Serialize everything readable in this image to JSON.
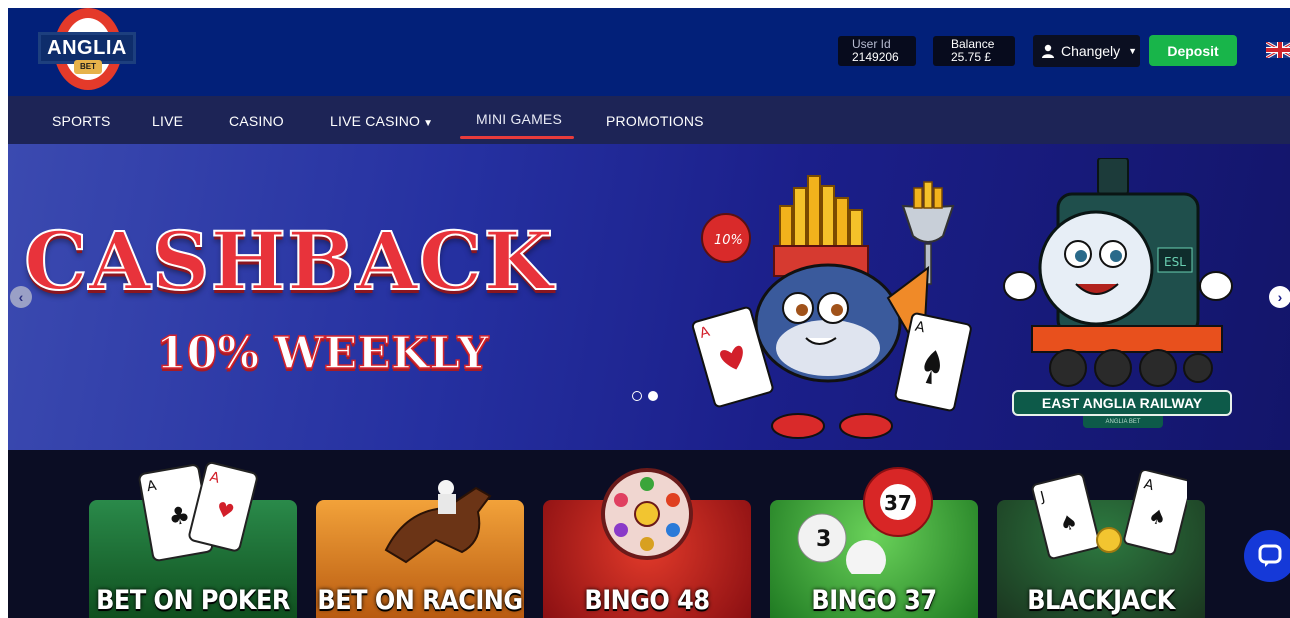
{
  "header": {
    "logo_text": "ANGLIA",
    "logo_sub": "BET",
    "user_id_label": "User Id",
    "user_id_value": "2149206",
    "balance_label": "Balance",
    "balance_value": "25.75 £",
    "user_name": "Changely",
    "deposit_label": "Deposit",
    "flag": "uk-flag"
  },
  "nav": {
    "items": [
      {
        "label": "SPORTS"
      },
      {
        "label": "LIVE"
      },
      {
        "label": "CASINO"
      },
      {
        "label": "LIVE CASINO"
      },
      {
        "label": "MINI GAMES"
      },
      {
        "label": "PROMOTIONS"
      }
    ],
    "active": "MINI GAMES"
  },
  "banner": {
    "title": "CASHBACK",
    "subtitle": "10% WEEKLY",
    "card_left_text": "10%",
    "train_badge": "ESL",
    "railway_label": "EAST ANGLIA RAILWAY",
    "railway_sub": "ANGLIA BET",
    "slides_total": 2,
    "slide_active": 2
  },
  "games": [
    {
      "label": "BET ON POKER",
      "color": "#1f7a3c"
    },
    {
      "label": "BET ON RACING",
      "color": "#e08a1a"
    },
    {
      "label": "BINGO 48",
      "color": "#c01e1e"
    },
    {
      "label": "BINGO 37",
      "color": "#3fae35"
    },
    {
      "label": "BLACKJACK",
      "color": "#2b2e33"
    }
  ],
  "colors": {
    "header_bg": "#022079",
    "nav_bg": "#1d2456",
    "deposit": "#18b54a",
    "accent_red": "#e8333b"
  }
}
